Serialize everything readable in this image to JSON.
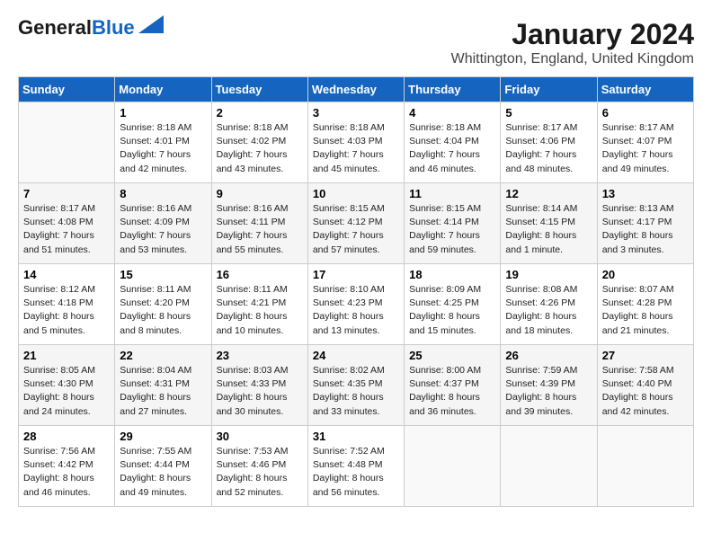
{
  "header": {
    "logo_line1": "General",
    "logo_line2": "Blue",
    "month": "January 2024",
    "location": "Whittington, England, United Kingdom"
  },
  "weekdays": [
    "Sunday",
    "Monday",
    "Tuesday",
    "Wednesday",
    "Thursday",
    "Friday",
    "Saturday"
  ],
  "weeks": [
    [
      {
        "day": "",
        "sunrise": "",
        "sunset": "",
        "daylight": ""
      },
      {
        "day": "1",
        "sunrise": "Sunrise: 8:18 AM",
        "sunset": "Sunset: 4:01 PM",
        "daylight": "Daylight: 7 hours and 42 minutes."
      },
      {
        "day": "2",
        "sunrise": "Sunrise: 8:18 AM",
        "sunset": "Sunset: 4:02 PM",
        "daylight": "Daylight: 7 hours and 43 minutes."
      },
      {
        "day": "3",
        "sunrise": "Sunrise: 8:18 AM",
        "sunset": "Sunset: 4:03 PM",
        "daylight": "Daylight: 7 hours and 45 minutes."
      },
      {
        "day": "4",
        "sunrise": "Sunrise: 8:18 AM",
        "sunset": "Sunset: 4:04 PM",
        "daylight": "Daylight: 7 hours and 46 minutes."
      },
      {
        "day": "5",
        "sunrise": "Sunrise: 8:17 AM",
        "sunset": "Sunset: 4:06 PM",
        "daylight": "Daylight: 7 hours and 48 minutes."
      },
      {
        "day": "6",
        "sunrise": "Sunrise: 8:17 AM",
        "sunset": "Sunset: 4:07 PM",
        "daylight": "Daylight: 7 hours and 49 minutes."
      }
    ],
    [
      {
        "day": "7",
        "sunrise": "Sunrise: 8:17 AM",
        "sunset": "Sunset: 4:08 PM",
        "daylight": "Daylight: 7 hours and 51 minutes."
      },
      {
        "day": "8",
        "sunrise": "Sunrise: 8:16 AM",
        "sunset": "Sunset: 4:09 PM",
        "daylight": "Daylight: 7 hours and 53 minutes."
      },
      {
        "day": "9",
        "sunrise": "Sunrise: 8:16 AM",
        "sunset": "Sunset: 4:11 PM",
        "daylight": "Daylight: 7 hours and 55 minutes."
      },
      {
        "day": "10",
        "sunrise": "Sunrise: 8:15 AM",
        "sunset": "Sunset: 4:12 PM",
        "daylight": "Daylight: 7 hours and 57 minutes."
      },
      {
        "day": "11",
        "sunrise": "Sunrise: 8:15 AM",
        "sunset": "Sunset: 4:14 PM",
        "daylight": "Daylight: 7 hours and 59 minutes."
      },
      {
        "day": "12",
        "sunrise": "Sunrise: 8:14 AM",
        "sunset": "Sunset: 4:15 PM",
        "daylight": "Daylight: 8 hours and 1 minute."
      },
      {
        "day": "13",
        "sunrise": "Sunrise: 8:13 AM",
        "sunset": "Sunset: 4:17 PM",
        "daylight": "Daylight: 8 hours and 3 minutes."
      }
    ],
    [
      {
        "day": "14",
        "sunrise": "Sunrise: 8:12 AM",
        "sunset": "Sunset: 4:18 PM",
        "daylight": "Daylight: 8 hours and 5 minutes."
      },
      {
        "day": "15",
        "sunrise": "Sunrise: 8:11 AM",
        "sunset": "Sunset: 4:20 PM",
        "daylight": "Daylight: 8 hours and 8 minutes."
      },
      {
        "day": "16",
        "sunrise": "Sunrise: 8:11 AM",
        "sunset": "Sunset: 4:21 PM",
        "daylight": "Daylight: 8 hours and 10 minutes."
      },
      {
        "day": "17",
        "sunrise": "Sunrise: 8:10 AM",
        "sunset": "Sunset: 4:23 PM",
        "daylight": "Daylight: 8 hours and 13 minutes."
      },
      {
        "day": "18",
        "sunrise": "Sunrise: 8:09 AM",
        "sunset": "Sunset: 4:25 PM",
        "daylight": "Daylight: 8 hours and 15 minutes."
      },
      {
        "day": "19",
        "sunrise": "Sunrise: 8:08 AM",
        "sunset": "Sunset: 4:26 PM",
        "daylight": "Daylight: 8 hours and 18 minutes."
      },
      {
        "day": "20",
        "sunrise": "Sunrise: 8:07 AM",
        "sunset": "Sunset: 4:28 PM",
        "daylight": "Daylight: 8 hours and 21 minutes."
      }
    ],
    [
      {
        "day": "21",
        "sunrise": "Sunrise: 8:05 AM",
        "sunset": "Sunset: 4:30 PM",
        "daylight": "Daylight: 8 hours and 24 minutes."
      },
      {
        "day": "22",
        "sunrise": "Sunrise: 8:04 AM",
        "sunset": "Sunset: 4:31 PM",
        "daylight": "Daylight: 8 hours and 27 minutes."
      },
      {
        "day": "23",
        "sunrise": "Sunrise: 8:03 AM",
        "sunset": "Sunset: 4:33 PM",
        "daylight": "Daylight: 8 hours and 30 minutes."
      },
      {
        "day": "24",
        "sunrise": "Sunrise: 8:02 AM",
        "sunset": "Sunset: 4:35 PM",
        "daylight": "Daylight: 8 hours and 33 minutes."
      },
      {
        "day": "25",
        "sunrise": "Sunrise: 8:00 AM",
        "sunset": "Sunset: 4:37 PM",
        "daylight": "Daylight: 8 hours and 36 minutes."
      },
      {
        "day": "26",
        "sunrise": "Sunrise: 7:59 AM",
        "sunset": "Sunset: 4:39 PM",
        "daylight": "Daylight: 8 hours and 39 minutes."
      },
      {
        "day": "27",
        "sunrise": "Sunrise: 7:58 AM",
        "sunset": "Sunset: 4:40 PM",
        "daylight": "Daylight: 8 hours and 42 minutes."
      }
    ],
    [
      {
        "day": "28",
        "sunrise": "Sunrise: 7:56 AM",
        "sunset": "Sunset: 4:42 PM",
        "daylight": "Daylight: 8 hours and 46 minutes."
      },
      {
        "day": "29",
        "sunrise": "Sunrise: 7:55 AM",
        "sunset": "Sunset: 4:44 PM",
        "daylight": "Daylight: 8 hours and 49 minutes."
      },
      {
        "day": "30",
        "sunrise": "Sunrise: 7:53 AM",
        "sunset": "Sunset: 4:46 PM",
        "daylight": "Daylight: 8 hours and 52 minutes."
      },
      {
        "day": "31",
        "sunrise": "Sunrise: 7:52 AM",
        "sunset": "Sunset: 4:48 PM",
        "daylight": "Daylight: 8 hours and 56 minutes."
      },
      {
        "day": "",
        "sunrise": "",
        "sunset": "",
        "daylight": ""
      },
      {
        "day": "",
        "sunrise": "",
        "sunset": "",
        "daylight": ""
      },
      {
        "day": "",
        "sunrise": "",
        "sunset": "",
        "daylight": ""
      }
    ]
  ]
}
